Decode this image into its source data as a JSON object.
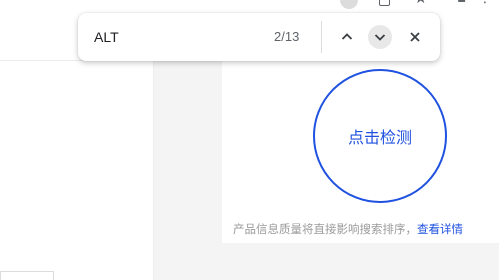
{
  "find_bar": {
    "query": "ALT",
    "match_count": "2/13"
  },
  "main": {
    "detect_button_label": "点击检测",
    "notice_text": "产品信息质量将直接影响搜索排序，",
    "notice_link": "查看详情"
  },
  "colors": {
    "accent": "#2052e0",
    "muted_text": "#9a9a9a"
  }
}
